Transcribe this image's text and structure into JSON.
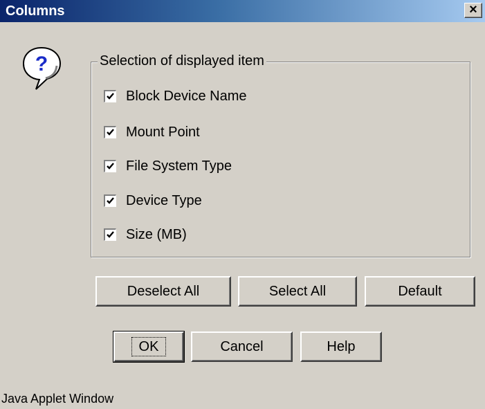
{
  "window": {
    "title": "Columns",
    "close_glyph": "×"
  },
  "icon": {
    "name": "question-icon",
    "glyph": "?"
  },
  "group": {
    "legend": "Selection of displayed item",
    "items": [
      {
        "label": "Block Device Name",
        "checked": true
      },
      {
        "label": "Mount Point",
        "checked": true
      },
      {
        "label": "File System Type",
        "checked": true
      },
      {
        "label": "Device Type",
        "checked": true
      },
      {
        "label": "Size (MB)",
        "checked": true
      }
    ]
  },
  "selection_buttons": {
    "deselect_all": "Deselect All",
    "select_all": "Select All",
    "default": "Default"
  },
  "dialog_buttons": {
    "ok": "OK",
    "cancel": "Cancel",
    "help": "Help"
  },
  "footer": {
    "text": "Java Applet Window"
  },
  "colors": {
    "titlebar_start": "#0a246a",
    "titlebar_end": "#a6caf0",
    "dialog_bg": "#d4d0c8"
  }
}
